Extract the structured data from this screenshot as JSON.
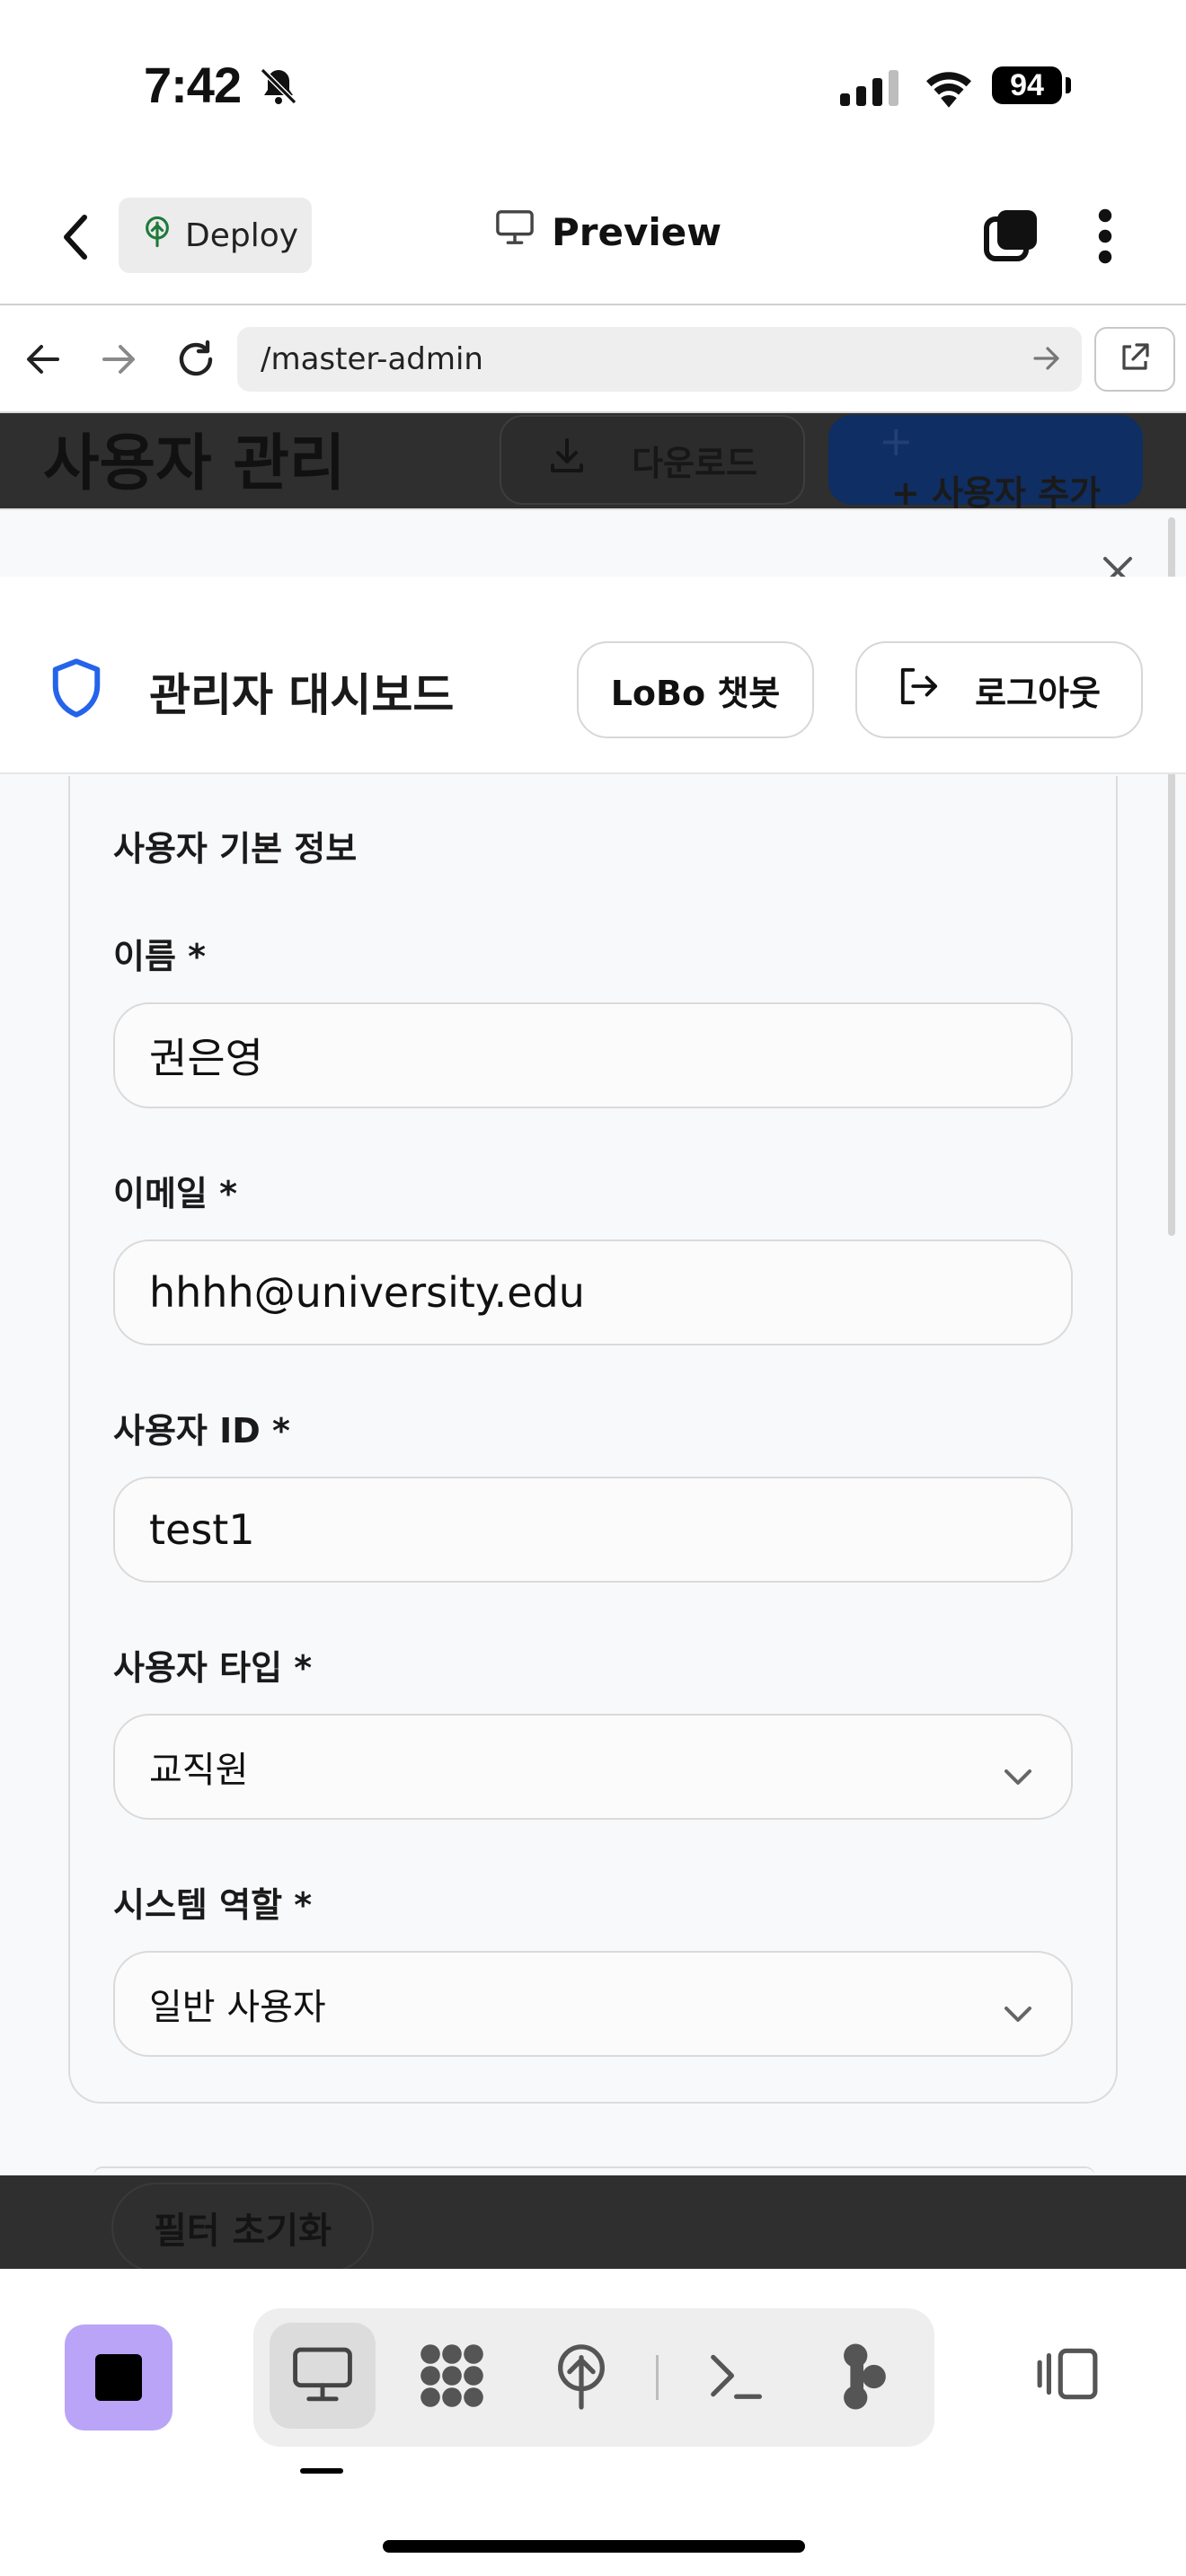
{
  "status_bar": {
    "time": "7:42",
    "battery": "94"
  },
  "app_header": {
    "deploy_label": "Deploy",
    "preview_label": "Preview"
  },
  "browser": {
    "url": "/master-admin"
  },
  "background_page": {
    "title": "사용자 관리",
    "download_label": "다운로드",
    "add_plus": "+",
    "add_user_label": "+ 사용자 추가",
    "reset_filter_label": "필터 초기화"
  },
  "dashboard": {
    "title": "관리자 대시보드",
    "chatbot_label": "LoBo 챗봇",
    "logout_label": "로그아웃"
  },
  "form": {
    "section_title": "사용자 기본 정보",
    "fields": [
      {
        "label": "이름 *",
        "value": "권은영"
      },
      {
        "label": "이메일 *",
        "value": "hhhh@university.edu"
      },
      {
        "label": "사용자 ID *",
        "value": "test1"
      },
      {
        "label": "사용자 타입 *",
        "value": "교직원"
      },
      {
        "label": "시스템 역할 *",
        "value": "일반 사용자"
      }
    ]
  },
  "colors": {
    "accent_blue": "#2563eb",
    "stop_button": "#b9a4f7",
    "deploy_icon": "#1f7a3a"
  },
  "icons": [
    "back-icon",
    "deploy-icon",
    "monitor-icon",
    "tabs-icon",
    "more-icon",
    "nav-back-icon",
    "nav-forward-icon",
    "reload-icon",
    "external-link-icon",
    "shield-icon",
    "logout-icon",
    "close-icon",
    "chevron-down-icon",
    "stop-icon",
    "preview-tool-icon",
    "apps-tool-icon",
    "deploy-tool-icon",
    "terminal-tool-icon",
    "git-tool-icon",
    "sidebar-toggle-icon"
  ]
}
